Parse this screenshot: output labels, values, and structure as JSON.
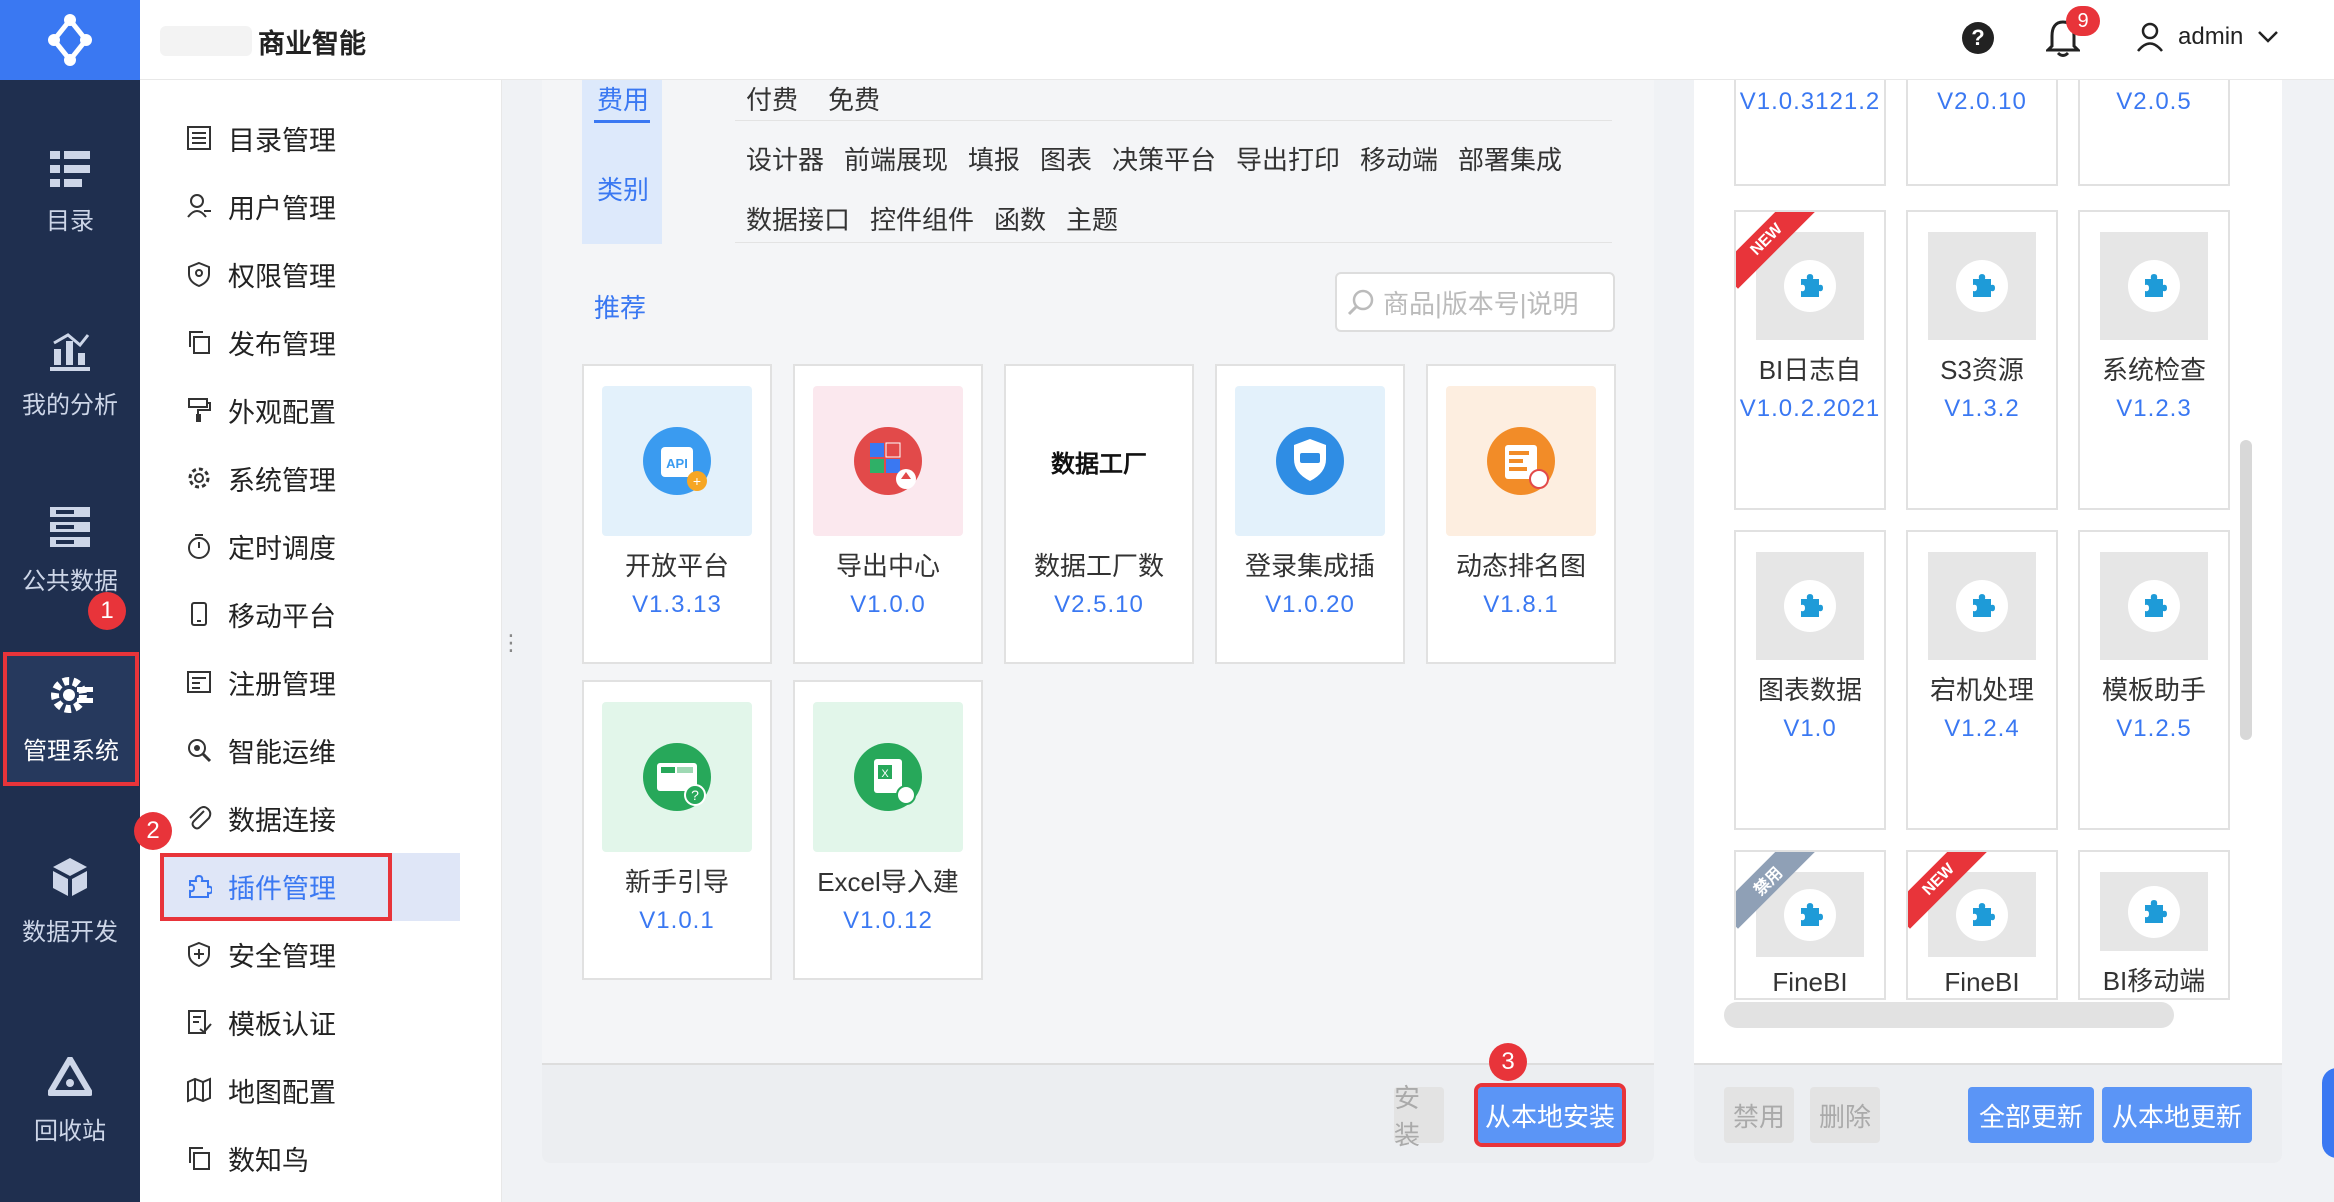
{
  "header": {
    "brand": "商业智能",
    "help_icon": "?",
    "notification_count": "9",
    "user_name": "admin"
  },
  "rail": {
    "items": [
      {
        "label": "目录",
        "icon": "catalog-icon"
      },
      {
        "label": "我的分析",
        "icon": "analysis-icon"
      },
      {
        "label": "公共数据",
        "icon": "public-data-icon"
      },
      {
        "label": "管理系统",
        "icon": "gear-icon"
      },
      {
        "label": "数据开发",
        "icon": "cubes-icon"
      },
      {
        "label": "回收站",
        "icon": "recycle-icon"
      }
    ],
    "step1": "1"
  },
  "sidebar": {
    "items": [
      {
        "label": "目录管理"
      },
      {
        "label": "用户管理"
      },
      {
        "label": "权限管理"
      },
      {
        "label": "发布管理"
      },
      {
        "label": "外观配置"
      },
      {
        "label": "系统管理"
      },
      {
        "label": "定时调度"
      },
      {
        "label": "移动平台"
      },
      {
        "label": "注册管理"
      },
      {
        "label": "智能运维"
      },
      {
        "label": "数据连接"
      },
      {
        "label": "插件管理"
      },
      {
        "label": "安全管理"
      },
      {
        "label": "模板认证"
      },
      {
        "label": "地图配置"
      },
      {
        "label": "数知鸟"
      }
    ],
    "step2": "2"
  },
  "filters": {
    "fee_tab": "费用",
    "category_tab": "类别",
    "fee_options": [
      "付费",
      "免费"
    ],
    "category_row1": [
      "设计器",
      "前端展现",
      "填报",
      "图表",
      "决策平台",
      "导出打印",
      "移动端",
      "部署集成"
    ],
    "category_row2": [
      "数据接口",
      "控件组件",
      "函数",
      "主题"
    ]
  },
  "store": {
    "recommend_label": "推荐",
    "search_placeholder": "商品|版本号|说明",
    "plugins": [
      {
        "name": "开放平台",
        "version": "V1.3.13"
      },
      {
        "name": "导出中心",
        "version": "V1.0.0"
      },
      {
        "name": "数据工厂数",
        "version": "V2.5.10",
        "logo_text": "数据工厂"
      },
      {
        "name": "登录集成插",
        "version": "V1.0.20"
      },
      {
        "name": "动态排名图",
        "version": "V1.8.1"
      },
      {
        "name": "新手引导",
        "version": "V1.0.1"
      },
      {
        "name": "Excel导入建",
        "version": "V1.0.12"
      }
    ],
    "install_label": "安装",
    "install_local_label": "从本地安装",
    "step3": "3"
  },
  "installed": {
    "top_versions": [
      "V1.0.3121.2",
      "V2.0.10",
      "V2.0.5"
    ],
    "plugins": [
      {
        "name": "BI日志自",
        "version": "V1.0.2.2021",
        "ribbon": "NEW"
      },
      {
        "name": "S3资源",
        "version": "V1.3.2",
        "ribbon": ""
      },
      {
        "name": "系统检查",
        "version": "V1.2.3",
        "ribbon": ""
      },
      {
        "name": "图表数据",
        "version": "V1.0",
        "ribbon": ""
      },
      {
        "name": "宕机处理",
        "version": "V1.2.4",
        "ribbon": ""
      },
      {
        "name": "模板助手",
        "version": "V1.2.5",
        "ribbon": ""
      },
      {
        "name": "FineBI",
        "version": "",
        "ribbon": "禁用"
      },
      {
        "name": "FineBI",
        "version": "",
        "ribbon": "NEW"
      },
      {
        "name": "BI移动端",
        "version": "",
        "ribbon": ""
      }
    ],
    "disable_label": "禁用",
    "delete_label": "删除",
    "update_all_label": "全部更新",
    "update_local_label": "从本地更新"
  },
  "colors": {
    "accent": "#3a78f2",
    "rail_bg": "#1f2f4f",
    "highlight_red": "#e8343a"
  }
}
